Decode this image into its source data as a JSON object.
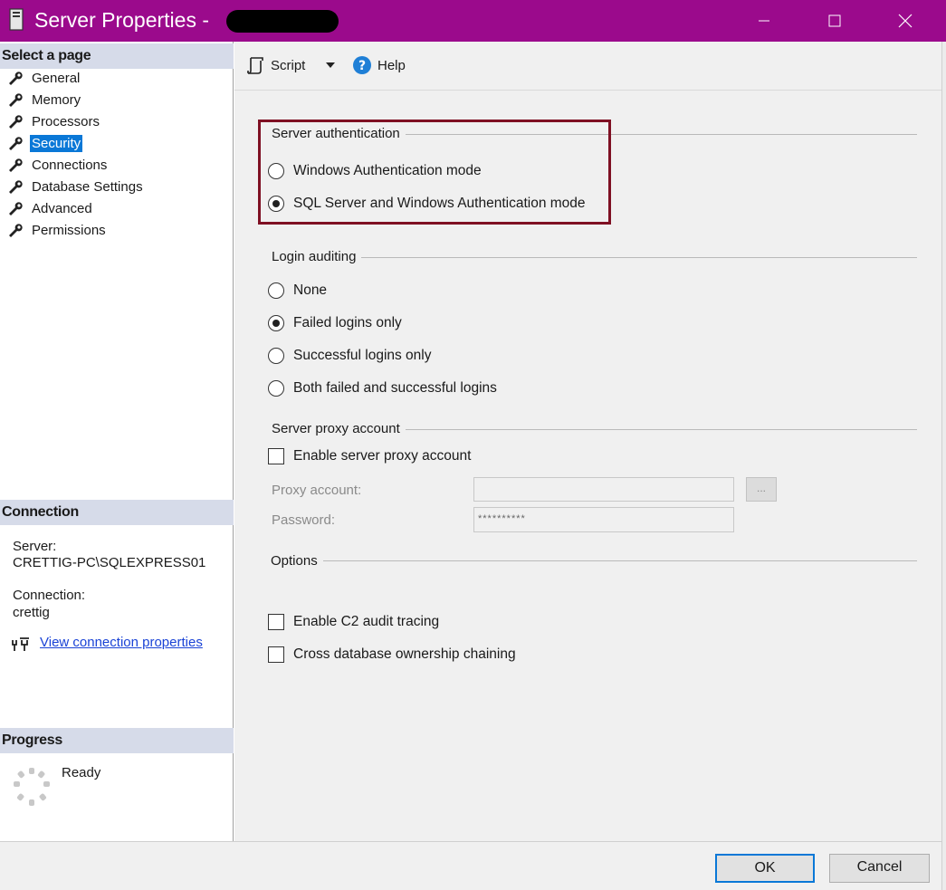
{
  "window": {
    "title": "Server Properties -",
    "title_color": "#9b0a8c",
    "icons": [
      "server-icon",
      "minimize-icon",
      "maximize-icon",
      "close-icon"
    ]
  },
  "left": {
    "select_page_header": "Select a page",
    "pages": [
      {
        "label": "General",
        "selected": false
      },
      {
        "label": "Memory",
        "selected": false
      },
      {
        "label": "Processors",
        "selected": false
      },
      {
        "label": "Security",
        "selected": true
      },
      {
        "label": "Connections",
        "selected": false
      },
      {
        "label": "Database Settings",
        "selected": false
      },
      {
        "label": "Advanced",
        "selected": false
      },
      {
        "label": "Permissions",
        "selected": false
      }
    ],
    "connection_header": "Connection",
    "server_label": "Server:",
    "server_value": "CRETTIG-PC\\SQLEXPRESS01",
    "connection_label": "Connection:",
    "connection_value": "crettig",
    "view_link": "View connection properties",
    "progress_header": "Progress",
    "progress_status": "Ready"
  },
  "toolbar": {
    "script_label": "Script",
    "help_label": "Help"
  },
  "security": {
    "server_auth": {
      "title": "Server authentication",
      "options": [
        {
          "label": "Windows Authentication mode",
          "checked": false
        },
        {
          "label": "SQL Server and Windows Authentication mode",
          "checked": true
        }
      ]
    },
    "login_auditing": {
      "title": "Login auditing",
      "options": [
        {
          "label": "None",
          "checked": false
        },
        {
          "label": "Failed logins only",
          "checked": true
        },
        {
          "label": "Successful logins only",
          "checked": false
        },
        {
          "label": "Both failed and successful logins",
          "checked": false
        }
      ]
    },
    "proxy": {
      "title": "Server proxy account",
      "enable_label": "Enable server proxy account",
      "enable_checked": false,
      "proxy_account_label": "Proxy account:",
      "proxy_account_value": "",
      "password_label": "Password:",
      "password_value": "**********",
      "browse_label": "..."
    },
    "options": {
      "title": "Options",
      "items": [
        {
          "label": "Enable C2 audit tracing",
          "checked": false
        },
        {
          "label": "Cross database ownership chaining",
          "checked": false
        }
      ]
    }
  },
  "buttons": {
    "ok": "OK",
    "cancel": "Cancel"
  }
}
